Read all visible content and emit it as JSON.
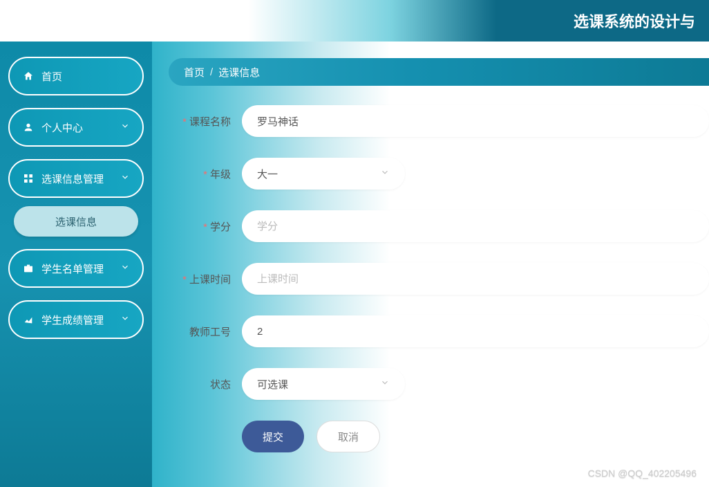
{
  "header": {
    "title": "选课系统的设计与"
  },
  "sidebar": {
    "items": [
      {
        "label": "首页",
        "icon": "home-icon",
        "expandable": false
      },
      {
        "label": "个人中心",
        "icon": "user-icon",
        "expandable": true
      },
      {
        "label": "选课信息管理",
        "icon": "grid-icon",
        "expandable": true
      },
      {
        "label": "学生名单管理",
        "icon": "briefcase-icon",
        "expandable": true
      },
      {
        "label": "学生成绩管理",
        "icon": "chart-icon",
        "expandable": true
      }
    ],
    "sub_item": {
      "label": "选课信息"
    }
  },
  "breadcrumb": {
    "home": "首页",
    "current": "选课信息"
  },
  "form": {
    "course_name": {
      "label": "课程名称",
      "value": "罗马神话"
    },
    "grade": {
      "label": "年级",
      "value": "大一"
    },
    "credit": {
      "label": "学分",
      "placeholder": "学分",
      "value": ""
    },
    "class_time": {
      "label": "上课时间",
      "placeholder": "上课时间",
      "value": ""
    },
    "teacher_id": {
      "label": "教师工号",
      "value": "2"
    },
    "status": {
      "label": "状态",
      "value": "可选课"
    }
  },
  "buttons": {
    "submit": "提交",
    "cancel": "取消"
  },
  "watermark": "CSDN @QQ_402205496"
}
